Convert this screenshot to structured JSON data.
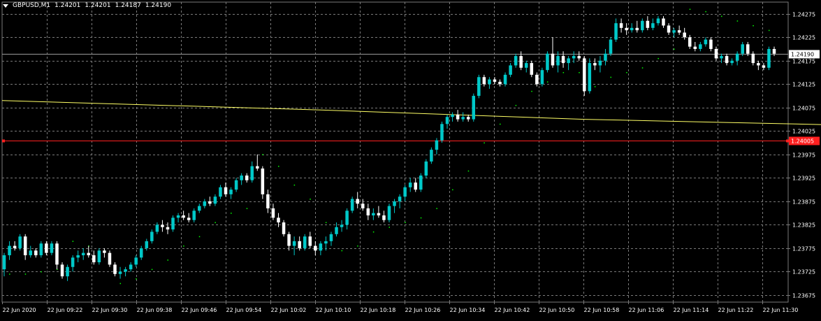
{
  "header": {
    "symbol": "GBPUSD,M1",
    "open": "1.24201",
    "high": "1.24201",
    "low": "1.24187",
    "close": "1.24190"
  },
  "colors": {
    "background": "#000000",
    "grid": "#7a7a7a",
    "bull": "#00c8c8",
    "bear": "#ffffff",
    "ma_line": "#ffff66",
    "sar": "#00ff00",
    "alert_line": "#ff2020",
    "text": "#ffffff"
  },
  "price_labels": {
    "current": "1.24190",
    "alert": "1.24005"
  },
  "chart_data": {
    "type": "candlestick",
    "title": "GBPUSD,M1",
    "ylim": [
      1.2366,
      1.243
    ],
    "yticks": [
      "1.24275",
      "1.24225",
      "1.24175",
      "1.24125",
      "1.24075",
      "1.24025",
      "1.23975",
      "1.23925",
      "1.23875",
      "1.23825",
      "1.23775",
      "1.23725",
      "1.23675"
    ],
    "xticks": [
      "22 Jun 2020",
      "22 Jun 09:22",
      "22 Jun 09:30",
      "22 Jun 09:38",
      "22 Jun 09:46",
      "22 Jun 09:54",
      "22 Jun 10:02",
      "22 Jun 10:10",
      "22 Jun 10:18",
      "22 Jun 10:26",
      "22 Jun 10:34",
      "22 Jun 10:42",
      "22 Jun 10:50",
      "22 Jun 10:58",
      "22 Jun 11:06",
      "22 Jun 11:14",
      "22 Jun 11:22",
      "22 Jun 11:30"
    ],
    "current_price": 1.2419,
    "alert_level": 1.24005,
    "moving_average": [
      {
        "bar": 0,
        "value": 1.2409
      },
      {
        "bar": 60,
        "value": 1.2407
      },
      {
        "bar": 110,
        "value": 1.2405
      },
      {
        "bar": 170,
        "value": 1.24035
      }
    ],
    "candles": [
      [
        1.2373,
        1.23765,
        1.23715,
        1.2376
      ],
      [
        1.2376,
        1.2379,
        1.2375,
        1.2378
      ],
      [
        1.2378,
        1.2379,
        1.2377,
        1.23775
      ],
      [
        1.23775,
        1.23805,
        1.2377,
        1.238
      ],
      [
        1.238,
        1.23805,
        1.2375,
        1.2376
      ],
      [
        1.2376,
        1.2378,
        1.23755,
        1.2377
      ],
      [
        1.2377,
        1.23775,
        1.23755,
        1.2376
      ],
      [
        1.2376,
        1.2379,
        1.23755,
        1.23785
      ],
      [
        1.23785,
        1.2379,
        1.2376,
        1.23765
      ],
      [
        1.23765,
        1.2379,
        1.2376,
        1.23785
      ],
      [
        1.23785,
        1.2379,
        1.2373,
        1.2374
      ],
      [
        1.2374,
        1.23745,
        1.2371,
        1.23715
      ],
      [
        1.23715,
        1.2374,
        1.23705,
        1.23735
      ],
      [
        1.23735,
        1.2376,
        1.23725,
        1.23755
      ],
      [
        1.23755,
        1.2377,
        1.23745,
        1.2376
      ],
      [
        1.2376,
        1.23775,
        1.2375,
        1.23765
      ],
      [
        1.23765,
        1.2378,
        1.23755,
        1.2376
      ],
      [
        1.2376,
        1.2377,
        1.2374,
        1.23745
      ],
      [
        1.23745,
        1.23775,
        1.2374,
        1.2377
      ],
      [
        1.2377,
        1.23775,
        1.23755,
        1.23765
      ],
      [
        1.23765,
        1.2377,
        1.23735,
        1.2374
      ],
      [
        1.2374,
        1.23745,
        1.23715,
        1.2372
      ],
      [
        1.2372,
        1.23735,
        1.2371,
        1.23725
      ],
      [
        1.23725,
        1.23735,
        1.23715,
        1.2373
      ],
      [
        1.2373,
        1.23745,
        1.23725,
        1.2374
      ],
      [
        1.2374,
        1.2376,
        1.23735,
        1.23755
      ],
      [
        1.23755,
        1.2378,
        1.2375,
        1.23775
      ],
      [
        1.23775,
        1.23795,
        1.2377,
        1.2379
      ],
      [
        1.2379,
        1.23815,
        1.23785,
        1.2381
      ],
      [
        1.2381,
        1.2383,
        1.23805,
        1.23825
      ],
      [
        1.23825,
        1.23835,
        1.2381,
        1.2382
      ],
      [
        1.2382,
        1.2383,
        1.23805,
        1.23815
      ],
      [
        1.23815,
        1.23845,
        1.2381,
        1.2384
      ],
      [
        1.2384,
        1.2385,
        1.2383,
        1.23845
      ],
      [
        1.23845,
        1.23855,
        1.23835,
        1.2384
      ],
      [
        1.2384,
        1.2385,
        1.2383,
        1.23835
      ],
      [
        1.23835,
        1.2386,
        1.2383,
        1.23855
      ],
      [
        1.23855,
        1.2387,
        1.2385,
        1.23865
      ],
      [
        1.23865,
        1.2388,
        1.2386,
        1.23875
      ],
      [
        1.23875,
        1.23885,
        1.23865,
        1.2387
      ],
      [
        1.2387,
        1.2389,
        1.23865,
        1.23885
      ],
      [
        1.23885,
        1.2391,
        1.2388,
        1.23905
      ],
      [
        1.23905,
        1.23915,
        1.23885,
        1.2389
      ],
      [
        1.2389,
        1.23905,
        1.2388,
        1.239
      ],
      [
        1.239,
        1.23925,
        1.23895,
        1.2392
      ],
      [
        1.2392,
        1.23935,
        1.2391,
        1.2393
      ],
      [
        1.2393,
        1.23935,
        1.23915,
        1.2392
      ],
      [
        1.2392,
        1.2396,
        1.23915,
        1.2395
      ],
      [
        1.2395,
        1.23975,
        1.2394,
        1.23945
      ],
      [
        1.23945,
        1.2395,
        1.2388,
        1.2389
      ],
      [
        1.2389,
        1.239,
        1.2385,
        1.2386
      ],
      [
        1.2386,
        1.2387,
        1.23835,
        1.2384
      ],
      [
        1.2384,
        1.2385,
        1.2382,
        1.2383
      ],
      [
        1.2383,
        1.23835,
        1.238,
        1.23805
      ],
      [
        1.23805,
        1.2381,
        1.2377,
        1.2378
      ],
      [
        1.2378,
        1.238,
        1.2376,
        1.2379
      ],
      [
        1.2379,
        1.238,
        1.2377,
        1.23775
      ],
      [
        1.23775,
        1.23805,
        1.2377,
        1.238
      ],
      [
        1.238,
        1.2381,
        1.23775,
        1.2378
      ],
      [
        1.2378,
        1.2379,
        1.2376,
        1.2377
      ],
      [
        1.2377,
        1.2379,
        1.2376,
        1.23785
      ],
      [
        1.23785,
        1.238,
        1.2377,
        1.2379
      ],
      [
        1.2379,
        1.2381,
        1.2378,
        1.23805
      ],
      [
        1.23805,
        1.2383,
        1.238,
        1.2382
      ],
      [
        1.2382,
        1.23835,
        1.2381,
        1.23825
      ],
      [
        1.23825,
        1.2386,
        1.23815,
        1.23855
      ],
      [
        1.23855,
        1.23885,
        1.2385,
        1.2388
      ],
      [
        1.2388,
        1.23895,
        1.2386,
        1.2387
      ],
      [
        1.2387,
        1.2388,
        1.23855,
        1.2386
      ],
      [
        1.2386,
        1.2387,
        1.23835,
        1.23845
      ],
      [
        1.23845,
        1.2386,
        1.23835,
        1.2385
      ],
      [
        1.2385,
        1.23865,
        1.2384,
        1.23845
      ],
      [
        1.23845,
        1.23855,
        1.2383,
        1.23835
      ],
      [
        1.23835,
        1.2387,
        1.2383,
        1.23865
      ],
      [
        1.23865,
        1.2388,
        1.2385,
        1.23875
      ],
      [
        1.23875,
        1.2389,
        1.2386,
        1.23885
      ],
      [
        1.23885,
        1.2391,
        1.23875,
        1.23905
      ],
      [
        1.23905,
        1.23925,
        1.23895,
        1.23915
      ],
      [
        1.23915,
        1.23925,
        1.23895,
        1.239
      ],
      [
        1.239,
        1.23935,
        1.23895,
        1.2393
      ],
      [
        1.2393,
        1.23965,
        1.23925,
        1.2396
      ],
      [
        1.2396,
        1.2399,
        1.23955,
        1.23985
      ],
      [
        1.23985,
        1.2401,
        1.23975,
        1.24005
      ],
      [
        1.24005,
        1.24045,
        1.24,
        1.2404
      ],
      [
        1.2404,
        1.2406,
        1.2403,
        1.24055
      ],
      [
        1.24055,
        1.24065,
        1.24045,
        1.2406
      ],
      [
        1.2406,
        1.2407,
        1.24045,
        1.2405
      ],
      [
        1.2405,
        1.24065,
        1.24045,
        1.24055
      ],
      [
        1.24055,
        1.2406,
        1.24045,
        1.2405
      ],
      [
        1.2405,
        1.24105,
        1.24045,
        1.241
      ],
      [
        1.241,
        1.24145,
        1.24095,
        1.2414
      ],
      [
        1.2414,
        1.24145,
        1.2412,
        1.24125
      ],
      [
        1.24125,
        1.2414,
        1.24115,
        1.24135
      ],
      [
        1.24135,
        1.2414,
        1.24125,
        1.2413
      ],
      [
        1.2413,
        1.24135,
        1.2412,
        1.24125
      ],
      [
        1.24125,
        1.2415,
        1.2412,
        1.24145
      ],
      [
        1.24145,
        1.2417,
        1.2414,
        1.24165
      ],
      [
        1.24165,
        1.2419,
        1.2416,
        1.24185
      ],
      [
        1.24185,
        1.24195,
        1.24155,
        1.2416
      ],
      [
        1.2416,
        1.24175,
        1.2415,
        1.2417
      ],
      [
        1.2417,
        1.24175,
        1.2414,
        1.24145
      ],
      [
        1.24145,
        1.2415,
        1.2412,
        1.24125
      ],
      [
        1.24125,
        1.2416,
        1.2412,
        1.24155
      ],
      [
        1.24155,
        1.24195,
        1.2415,
        1.2419
      ],
      [
        1.2419,
        1.24225,
        1.2416,
        1.24165
      ],
      [
        1.24165,
        1.24195,
        1.2415,
        1.24185
      ],
      [
        1.24185,
        1.24195,
        1.2416,
        1.2417
      ],
      [
        1.2417,
        1.24185,
        1.24155,
        1.2418
      ],
      [
        1.2418,
        1.24195,
        1.2417,
        1.24185
      ],
      [
        1.24185,
        1.24195,
        1.24175,
        1.2418
      ],
      [
        1.2418,
        1.24185,
        1.241,
        1.2411
      ],
      [
        1.2411,
        1.2418,
        1.24105,
        1.2417
      ],
      [
        1.2417,
        1.2418,
        1.24155,
        1.24165
      ],
      [
        1.24165,
        1.24185,
        1.2415,
        1.24175
      ],
      [
        1.24175,
        1.242,
        1.24165,
        1.2419
      ],
      [
        1.2419,
        1.24225,
        1.24185,
        1.2422
      ],
      [
        1.2422,
        1.24265,
        1.24215,
        1.24255
      ],
      [
        1.24255,
        1.24265,
        1.24235,
        1.24245
      ],
      [
        1.24245,
        1.24255,
        1.2423,
        1.2424
      ],
      [
        1.2424,
        1.24255,
        1.24235,
        1.24245
      ],
      [
        1.24245,
        1.2426,
        1.24235,
        1.2424
      ],
      [
        1.2424,
        1.24265,
        1.24235,
        1.2426
      ],
      [
        1.2426,
        1.2427,
        1.2424,
        1.24245
      ],
      [
        1.24245,
        1.24265,
        1.2424,
        1.24255
      ],
      [
        1.24255,
        1.2427,
        1.2425,
        1.24265
      ],
      [
        1.24265,
        1.2427,
        1.24245,
        1.2425
      ],
      [
        1.2425,
        1.24255,
        1.2423,
        1.24235
      ],
      [
        1.24235,
        1.24245,
        1.24225,
        1.2424
      ],
      [
        1.2424,
        1.2425,
        1.2423,
        1.24235
      ],
      [
        1.24235,
        1.24245,
        1.2422,
        1.24225
      ],
      [
        1.24225,
        1.2423,
        1.242,
        1.24205
      ],
      [
        1.24205,
        1.24215,
        1.24195,
        1.242
      ],
      [
        1.242,
        1.24215,
        1.24195,
        1.2421
      ],
      [
        1.2421,
        1.24225,
        1.24205,
        1.2422
      ],
      [
        1.2422,
        1.24225,
        1.24195,
        1.242
      ],
      [
        1.242,
        1.24205,
        1.24175,
        1.2418
      ],
      [
        1.2418,
        1.2419,
        1.2417,
        1.24185
      ],
      [
        1.24185,
        1.2419,
        1.24165,
        1.2417
      ],
      [
        1.2417,
        1.2418,
        1.24165,
        1.24175
      ],
      [
        1.24175,
        1.24195,
        1.24165,
        1.2419
      ],
      [
        1.2419,
        1.24215,
        1.24185,
        1.2421
      ],
      [
        1.2421,
        1.24215,
        1.24185,
        1.2419
      ],
      [
        1.2419,
        1.24195,
        1.24165,
        1.2417
      ],
      [
        1.2417,
        1.24175,
        1.24155,
        1.24165
      ],
      [
        1.24165,
        1.2417,
        1.24155,
        1.2416
      ],
      [
        1.2416,
        1.24205,
        1.24155,
        1.242
      ],
      [
        1.242,
        1.24205,
        1.24185,
        1.2419
      ]
    ],
    "parabolic_sar": [
      [
        1,
        1.2372
      ],
      [
        4,
        1.2372
      ],
      [
        7,
        1.23725
      ],
      [
        10,
        1.2373
      ],
      [
        13,
        1.2379
      ],
      [
        16,
        1.2378
      ],
      [
        19,
        1.2377
      ],
      [
        22,
        1.237
      ],
      [
        25,
        1.2371
      ],
      [
        28,
        1.2373
      ],
      [
        31,
        1.2375
      ],
      [
        34,
        1.2378
      ],
      [
        37,
        1.238
      ],
      [
        40,
        1.2383
      ],
      [
        43,
        1.2385
      ],
      [
        46,
        1.2386
      ],
      [
        49,
        1.23975
      ],
      [
        52,
        1.2395
      ],
      [
        55,
        1.2391
      ],
      [
        58,
        1.2388
      ],
      [
        61,
        1.2383
      ],
      [
        64,
        1.2377
      ],
      [
        67,
        1.2378
      ],
      [
        70,
        1.2381
      ],
      [
        73,
        1.2382
      ],
      [
        76,
        1.2383
      ],
      [
        79,
        1.2384
      ],
      [
        82,
        1.2386
      ],
      [
        85,
        1.239
      ],
      [
        88,
        1.2394
      ],
      [
        91,
        1.24
      ],
      [
        94,
        1.2404
      ],
      [
        97,
        1.2408
      ],
      [
        100,
        1.2411
      ],
      [
        103,
        1.2413
      ],
      [
        106,
        1.2415
      ],
      [
        109,
        1.2415
      ],
      [
        112,
        1.2412
      ],
      [
        115,
        1.2414
      ],
      [
        118,
        1.2415
      ],
      [
        121,
        1.2416
      ],
      [
        124,
        1.2418
      ],
      [
        127,
        1.242
      ],
      [
        130,
        1.24285
      ],
      [
        133,
        1.2428
      ],
      [
        136,
        1.2427
      ],
      [
        139,
        1.2426
      ],
      [
        142,
        1.2425
      ],
      [
        145,
        1.2424
      ]
    ]
  }
}
